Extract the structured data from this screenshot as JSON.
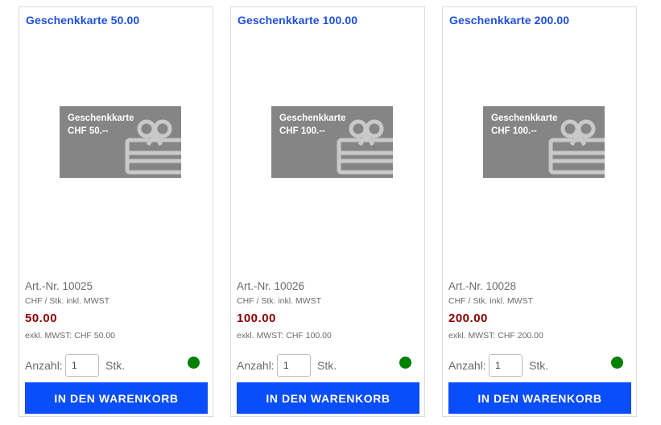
{
  "products": [
    {
      "title": "Geschenkkarte 50.00",
      "image_text": {
        "line1": "Geschenkkarte",
        "line2": "CHF  50.--"
      },
      "art_nr": "Art.-Nr. 10025",
      "unit_text": "CHF / Stk. inkl. MWST",
      "price": "50.00",
      "net_price": "exkl. MWST: CHF 50.00",
      "qty_label": "Anzahl:",
      "qty_value": "1",
      "qty_unit": "Stk.",
      "stock_status": "available",
      "stock_color": "#008000",
      "button_label": "IN DEN WARENKORB"
    },
    {
      "title": "Geschenkkarte 100.00",
      "image_text": {
        "line1": "Geschenkkarte",
        "line2": "CHF 100.--"
      },
      "art_nr": "Art.-Nr. 10026",
      "unit_text": "CHF / Stk. inkl. MWST",
      "price": "100.00",
      "net_price": "exkl. MWST: CHF 100.00",
      "qty_label": "Anzahl:",
      "qty_value": "1",
      "qty_unit": "Stk.",
      "stock_status": "available",
      "stock_color": "#008000",
      "button_label": "IN DEN WARENKORB"
    },
    {
      "title": "Geschenkkarte 200.00",
      "image_text": {
        "line1": "Geschenkkarte",
        "line2": "CHF 100.--"
      },
      "art_nr": "Art.-Nr. 10028",
      "unit_text": "CHF / Stk. inkl. MWST",
      "price": "200.00",
      "net_price": "exkl. MWST: CHF 200.00",
      "qty_label": "Anzahl:",
      "qty_value": "1",
      "qty_unit": "Stk.",
      "stock_status": "available",
      "stock_color": "#008000",
      "button_label": "IN DEN WARENKORB"
    }
  ],
  "colors": {
    "title_link": "#1f4fe0",
    "price": "#8b0000",
    "button_bg": "#0a4dfa",
    "image_bg": "#858585"
  },
  "icons": {
    "gift_card": "gift-bow-icon"
  }
}
